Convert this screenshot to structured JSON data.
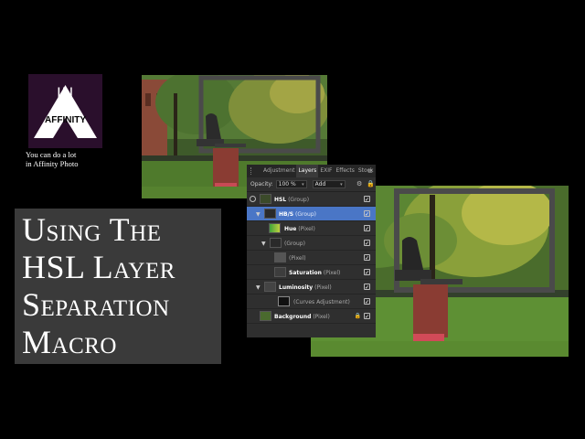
{
  "logo": {
    "line1": "IN",
    "line2": "AFFINITY",
    "icon": "affinity-triangle-logo",
    "brand_color": "#2a0f2c"
  },
  "tagline": {
    "line1": "You can do a lot",
    "line2": "in Affinity Photo"
  },
  "title": {
    "lines": [
      "Using The",
      "HSL Layer",
      "Separation",
      "Macro"
    ]
  },
  "panel": {
    "tabs": [
      {
        "label": "Adjustment",
        "active": false
      },
      {
        "label": "Layers",
        "active": true
      },
      {
        "label": "EXIF",
        "active": false
      },
      {
        "label": "Effects",
        "active": false
      },
      {
        "label": "Stock",
        "active": false
      }
    ],
    "opacity_label": "Opacity:",
    "opacity_value": "100 %",
    "blend_mode": "Add",
    "layers": [
      {
        "name": "HSL",
        "type": "(Group)"
      },
      {
        "name": "HB/S",
        "type": "(Group)"
      },
      {
        "name": "Hue",
        "type": "(Pixel)"
      },
      {
        "name": "",
        "type": "(Group)"
      },
      {
        "name": "",
        "type": "(Pixel)"
      },
      {
        "name": "Saturation",
        "type": "(Pixel)"
      },
      {
        "name": "Luminosity",
        "type": "(Pixel)"
      },
      {
        "name": "",
        "type": "(Curves Adjustment)"
      },
      {
        "name": "Background",
        "type": "(Pixel)"
      }
    ]
  }
}
